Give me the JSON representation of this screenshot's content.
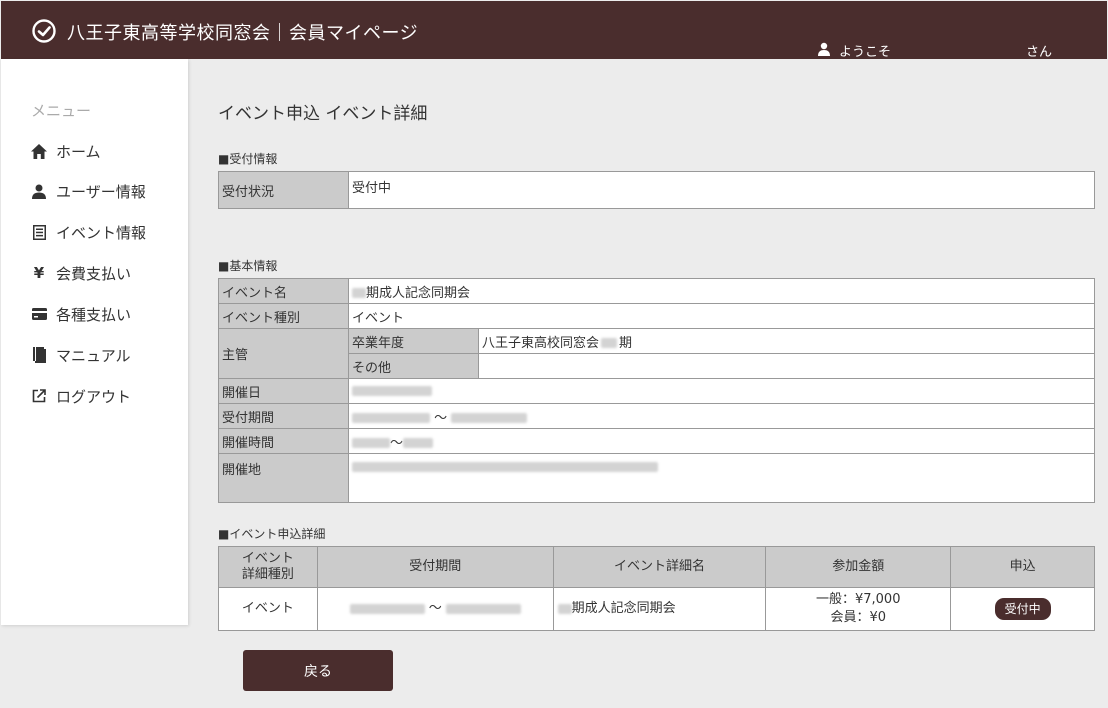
{
  "header": {
    "title": "八王子東高等学校同窓会｜会員マイページ",
    "welcome": "ようこそ",
    "san": "さん"
  },
  "sidebar": {
    "menu_title": "メニュー",
    "items": [
      {
        "label": "ホーム",
        "icon": "home-icon"
      },
      {
        "label": "ユーザー情報",
        "icon": "user-icon"
      },
      {
        "label": "イベント情報",
        "icon": "list-icon"
      },
      {
        "label": "会費支払い",
        "icon": "yen-icon"
      },
      {
        "label": "各種支払い",
        "icon": "card-icon"
      },
      {
        "label": "マニュアル",
        "icon": "book-icon"
      },
      {
        "label": "ログアウト",
        "icon": "logout-icon"
      }
    ],
    "yen_glyph": "¥"
  },
  "page_title": "イベント申込 イベント詳細",
  "reception": {
    "section_title": "■受付情報",
    "status_label": "受付状況",
    "status_value": "受付中"
  },
  "basic": {
    "section_title": "■基本情報",
    "event_name_label": "イベント名",
    "event_name_value": "期成人記念同期会",
    "event_type_label": "イベント種別",
    "event_type_value": "イベント",
    "organizer_label": "主管",
    "grad_year_label": "卒業年度",
    "grad_year_value_prefix": "八王子東高校同窓会",
    "grad_year_value_suffix": "期",
    "other_label": "その他",
    "other_value": "",
    "date_label": "開催日",
    "period_label": "受付期間",
    "tilde": "～",
    "time_label": "開催時間",
    "venue_label": "開催地"
  },
  "detail": {
    "section_title": "■イベント申込詳細",
    "headers": [
      "イベント\n詳細種別",
      "受付期間",
      "イベント詳細名",
      "参加金額",
      "申込"
    ],
    "row": {
      "type": "イベント",
      "tilde": "～",
      "name": "期成人記念同期会",
      "fee_general": "一般：¥7,000",
      "fee_member": "会員：¥0",
      "status": "受付中"
    }
  },
  "back_button": "戻る",
  "colors": {
    "brand": "#4a2d2d",
    "label_bg": "#cbcbcb",
    "page_bg": "#ececec"
  }
}
